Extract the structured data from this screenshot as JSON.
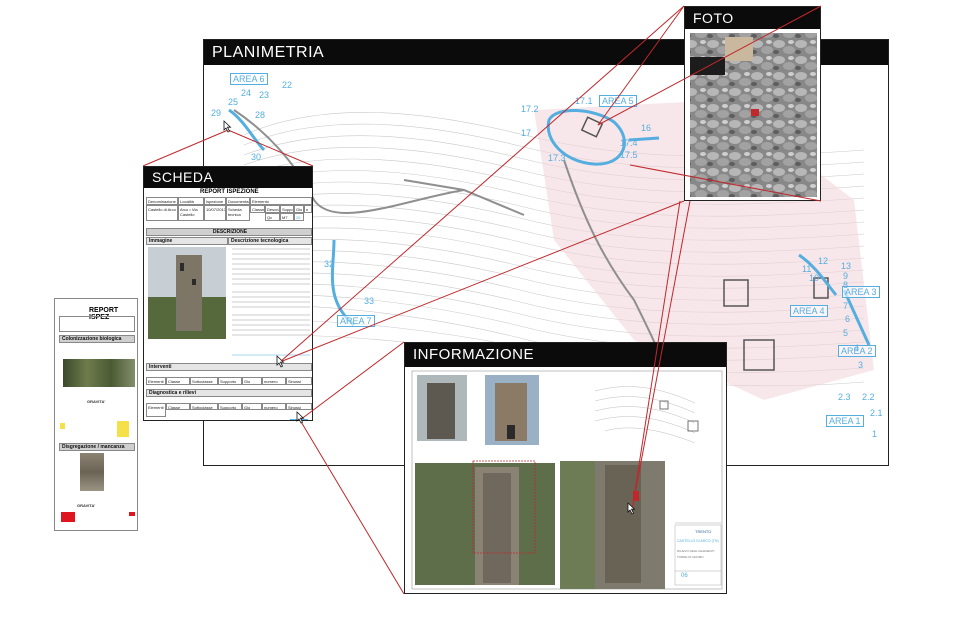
{
  "panels": {
    "planimetria": {
      "title": "PLANIMETRIA"
    },
    "foto": {
      "title": "FOTO"
    },
    "scheda": {
      "title": "SCHEDA"
    },
    "informazione": {
      "title": "INFORMAZIONE"
    }
  },
  "map_labels": {
    "areas": [
      "AREA 6",
      "AREA 5",
      "AREA 4",
      "AREA 3",
      "AREA 2",
      "AREA 1",
      "AREA 7"
    ],
    "numbers": [
      "22",
      "23",
      "24",
      "25",
      "29",
      "28",
      "30",
      "17.2",
      "17.1",
      "17",
      "17.3",
      "17.4",
      "17.5",
      "16",
      "32",
      "33",
      "12",
      "13",
      "11",
      "10",
      "9",
      "8",
      "7",
      "6",
      "5",
      "4",
      "3",
      "2.3",
      "2.2",
      "2.1",
      "1"
    ]
  },
  "scheda": {
    "report_title": "REPORT ISPEZIONE",
    "table_headers": [
      "Denominazione",
      "Località",
      "Ispezione",
      "Documentaz.",
      "Elemento"
    ],
    "table_values": [
      "Castello di Arco",
      "Arco • Via Castello",
      "10/07/2017",
      "Scheda tecnica"
    ],
    "element_headers": [
      "Classe",
      "Descrizione",
      "Supporto",
      "Gio",
      "n"
    ],
    "element_values": [
      "Qc",
      "M7",
      "26"
    ],
    "descrizione": "DESCRIZIONE",
    "immagine": "Immagine",
    "descrizione_tecnologica": "Descrizione tecnologica",
    "interventi": "Interventi",
    "diagnostica": "Diagnostica e rilievi",
    "cols": [
      "Elementi",
      "Classe",
      "Sottoclasse",
      "Supporto",
      "Gio",
      "numero",
      "Sinossi"
    ]
  },
  "report_back": {
    "report_title": "REPORT ISPEZ",
    "colonizzazione": "Colonizzazione biologica",
    "disgregazione": "Disgregazione / mancanza",
    "gravita": "GRAVITA'",
    "diagnostica": "Diagnostica"
  },
  "info_sheet": {
    "logo": "TRENTO",
    "lines": [
      "CASTELLO DI ARCO (TN)",
      "RILIEVO DEGLI ELEMENTI",
      "TORRE DI GRUMO"
    ],
    "num": "06"
  },
  "colors": {
    "accent_blue": "#55aee0",
    "zoom_red": "#c0282c",
    "header_black": "#0b0b0b",
    "highlight_yellow": "#f5e04a",
    "alert_red": "#e0141e"
  }
}
